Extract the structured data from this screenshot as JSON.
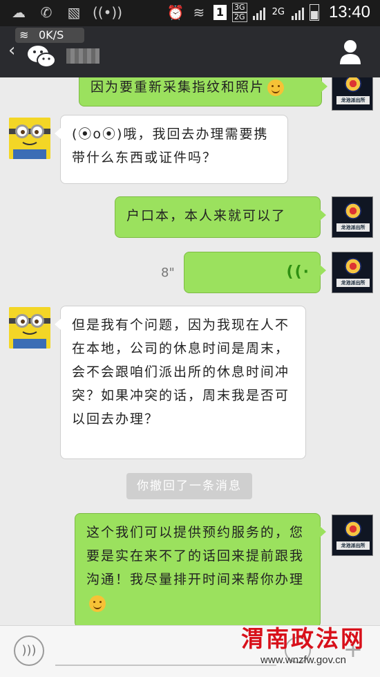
{
  "status_bar": {
    "time": "13:40",
    "network_3g": "3G",
    "network_2g_a": "2G",
    "network_2g_b": "2G",
    "sim_indicator": "1",
    "icons": [
      "cloud-icon",
      "wechat-notify-icon",
      "image-icon",
      "signal-broadcast-icon",
      "alarm-icon",
      "wifi-icon",
      "signal-bars-icon",
      "battery-icon"
    ]
  },
  "header": {
    "back_icon": "chevron-left-icon",
    "net_speed": "0K/S",
    "app_icon": "wechat-icon",
    "profile_icon": "person-icon"
  },
  "messages": [
    {
      "side": "right",
      "sender": "police",
      "text": "因为要重新采集指纹和照片",
      "emoji": "surprised-emoji"
    },
    {
      "side": "left",
      "sender": "user",
      "text": "(⦿o⦿)哦，我回去办理需要携带什么东西或证件吗？"
    },
    {
      "side": "right",
      "sender": "police",
      "text": "户口本，本人来就可以了"
    },
    {
      "side": "right",
      "sender": "police",
      "type": "voice",
      "duration": "8\""
    },
    {
      "side": "left",
      "sender": "user",
      "text": "但是我有个问题，因为我现在人不在本地，公司的休息时间是周末，会不会跟咱们派出所的休息时间冲突？如果冲突的话，周末我是否可以回去办理？"
    },
    {
      "type": "system",
      "text": "你撤回了一条消息"
    },
    {
      "side": "right",
      "sender": "police",
      "text": "这个我们可以提供预约服务的，您要是实在来不了的话回来提前跟我沟通！我尽量排开时间来帮你办理",
      "emoji": "smile-emoji"
    }
  ],
  "avatars": {
    "police_plaque": "龙池派出所"
  },
  "watermark": {
    "title": "渭南政法网",
    "url": "www.wnzfw.gov.cn"
  },
  "colors": {
    "green_bubble": "#9be15e",
    "header_bg": "#2a2b2f",
    "chat_bg": "#ebebeb",
    "watermark_red": "#d8101a"
  }
}
